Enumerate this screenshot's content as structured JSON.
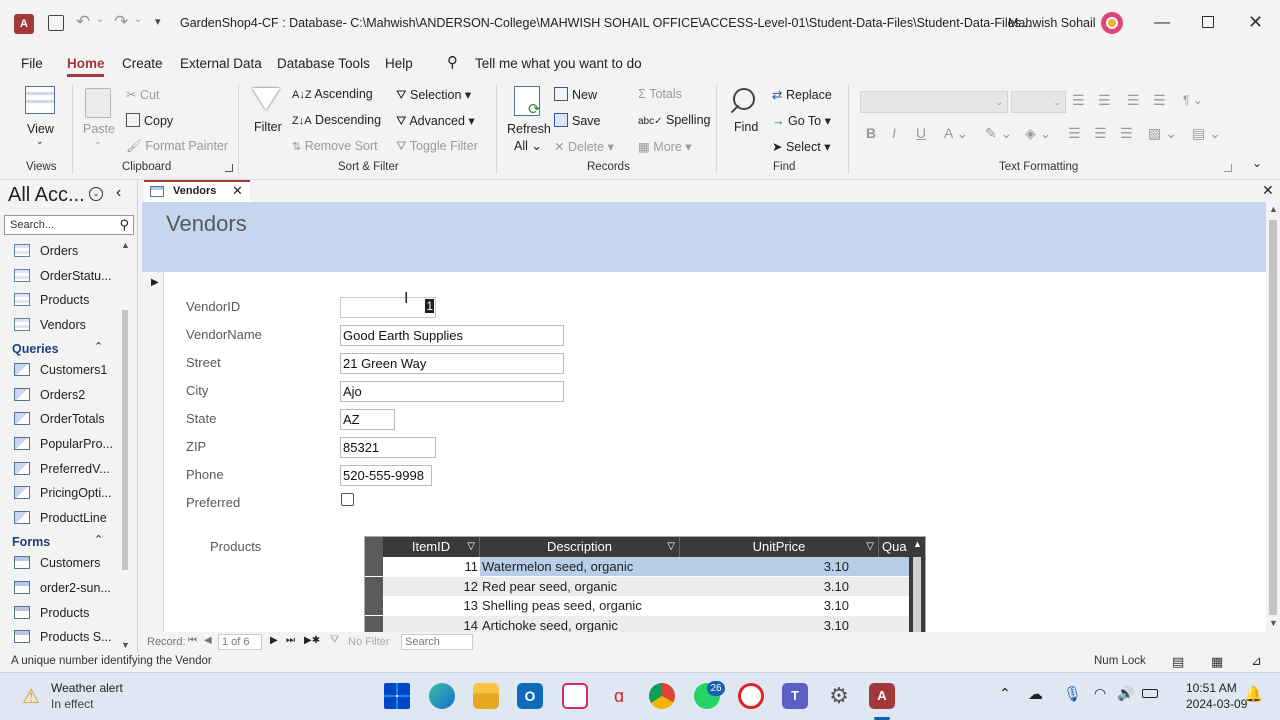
{
  "window": {
    "title": "GardenShop4-CF : Database- C:\\Mahwish\\ANDERSON-College\\MAHWISH SOHAIL OFFICE\\ACCESS-Level-01\\Student-Data-Files\\Student-Data-Files...",
    "user": "Mahwish Sohail"
  },
  "menu": {
    "items": [
      "File",
      "Home",
      "Create",
      "External Data",
      "Database Tools",
      "Help"
    ],
    "active": "Home",
    "search": "Tell me what you want to do"
  },
  "ribbon": {
    "views": {
      "view": "View",
      "group": "Views"
    },
    "clipboard": {
      "paste": "Paste",
      "cut": "Cut",
      "copy": "Copy",
      "format_painter": "Format Painter",
      "group": "Clipboard"
    },
    "sort_filter": {
      "filter": "Filter",
      "ascending": "Ascending",
      "descending": "Descending",
      "remove_sort": "Remove Sort",
      "selection": "Selection",
      "advanced": "Advanced",
      "toggle_filter": "Toggle Filter",
      "group": "Sort & Filter"
    },
    "records": {
      "refresh": "Refresh",
      "refresh_all": "All",
      "new": "New",
      "save": "Save",
      "delete": "Delete",
      "totals": "Totals",
      "spelling": "Spelling",
      "more": "More",
      "group": "Records"
    },
    "find": {
      "find": "Find",
      "replace": "Replace",
      "goto": "Go To",
      "select": "Select",
      "group": "Find"
    },
    "text_formatting": {
      "group": "Text Formatting"
    }
  },
  "nav": {
    "title": "All Acc...",
    "search_placeholder": "Search...",
    "tables": [
      "Orders",
      "OrderStatu...",
      "Products",
      "Vendors"
    ],
    "queries_label": "Queries",
    "queries": [
      "Customers1",
      "Orders2",
      "OrderTotals",
      "PopularPro...",
      "PreferredV...",
      "PricingOpti...",
      "ProductLine"
    ],
    "forms_label": "Forms",
    "forms": [
      "Customers",
      "order2-sun...",
      "Products",
      "Products S..."
    ]
  },
  "document": {
    "tab": "Vendors",
    "form_title": "Vendors",
    "fields": [
      {
        "label": "VendorID",
        "value": "1"
      },
      {
        "label": "VendorName",
        "value": "Good Earth Supplies"
      },
      {
        "label": "Street",
        "value": "21 Green Way"
      },
      {
        "label": "City",
        "value": "Ajo"
      },
      {
        "label": "State",
        "value": "AZ"
      },
      {
        "label": "ZIP",
        "value": "85321"
      },
      {
        "label": "Phone",
        "value": "520-555-9998"
      },
      {
        "label": "Preferred",
        "value": ""
      }
    ],
    "subform": {
      "label": "Products",
      "columns": [
        "ItemID",
        "Description",
        "UnitPrice",
        "Qua"
      ],
      "rows": [
        {
          "id": "11",
          "desc": "Watermelon seed, organic",
          "price": "3.10"
        },
        {
          "id": "12",
          "desc": "Red pear seed, organic",
          "price": "3.10"
        },
        {
          "id": "13",
          "desc": "Shelling peas seed, organic",
          "price": "3.10"
        },
        {
          "id": "14",
          "desc": "Artichoke seed, organic",
          "price": "3.10"
        }
      ]
    },
    "record_nav": {
      "label": "Record:",
      "position": "1 of 6",
      "filter": "No Filter",
      "search": "Search"
    }
  },
  "status": {
    "text": "A unique number identifying the Vendor",
    "numlock": "Num Lock"
  },
  "taskbar": {
    "weather_title": "Weather alert",
    "weather_sub": "In effect",
    "whatsapp_badge": "26",
    "time": "10:51 AM",
    "date": "2024-03-09"
  },
  "colors": {
    "access_red": "#a4373a",
    "header_blue": "#c6d6ee",
    "selection": "#b7cde8",
    "nav_header": "#1f3e7a"
  }
}
